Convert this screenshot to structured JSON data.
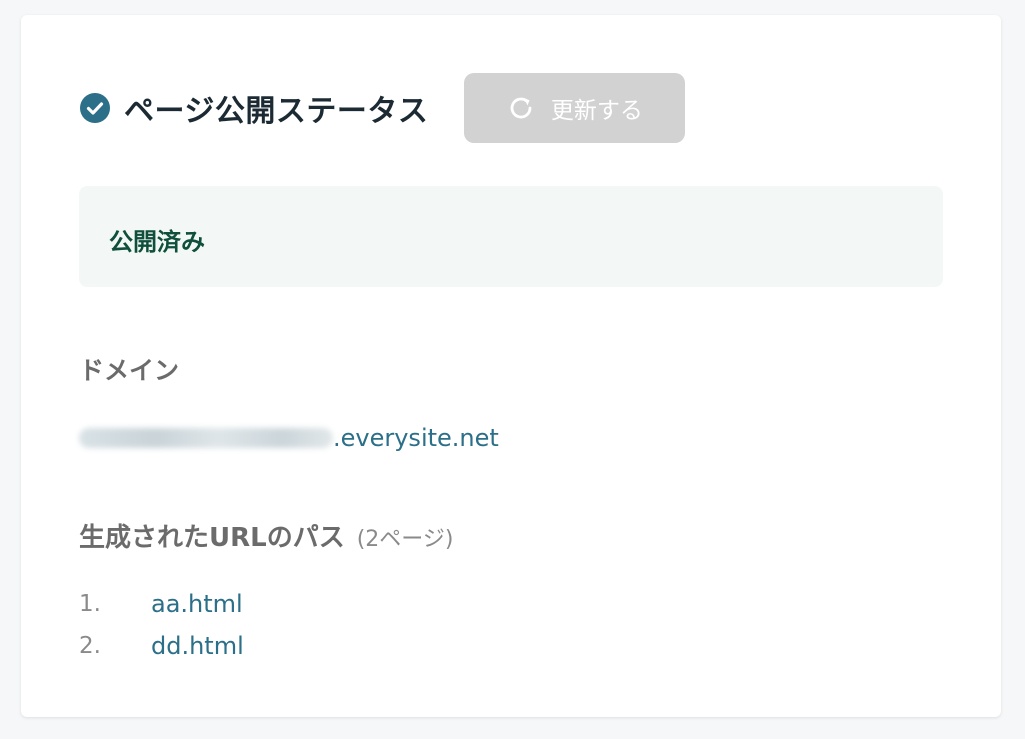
{
  "header": {
    "title": "ページ公開ステータス",
    "refresh_label": "更新する"
  },
  "status": {
    "text": "公開済み"
  },
  "domain": {
    "label": "ドメイン",
    "suffix": ".everysite.net"
  },
  "paths": {
    "label": "生成されたURLのパス",
    "count": "(2ページ)",
    "items": [
      {
        "num": "1.",
        "path": "aa.html"
      },
      {
        "num": "2.",
        "path": "dd.html"
      }
    ]
  },
  "colors": {
    "accent": "#2b6f88",
    "status_bg": "#f3f8f6",
    "status_text": "#0f4f3b",
    "button_disabled": "#d2d2d2"
  },
  "icons": {
    "status": "check-circle-icon",
    "refresh": "refresh-icon"
  }
}
